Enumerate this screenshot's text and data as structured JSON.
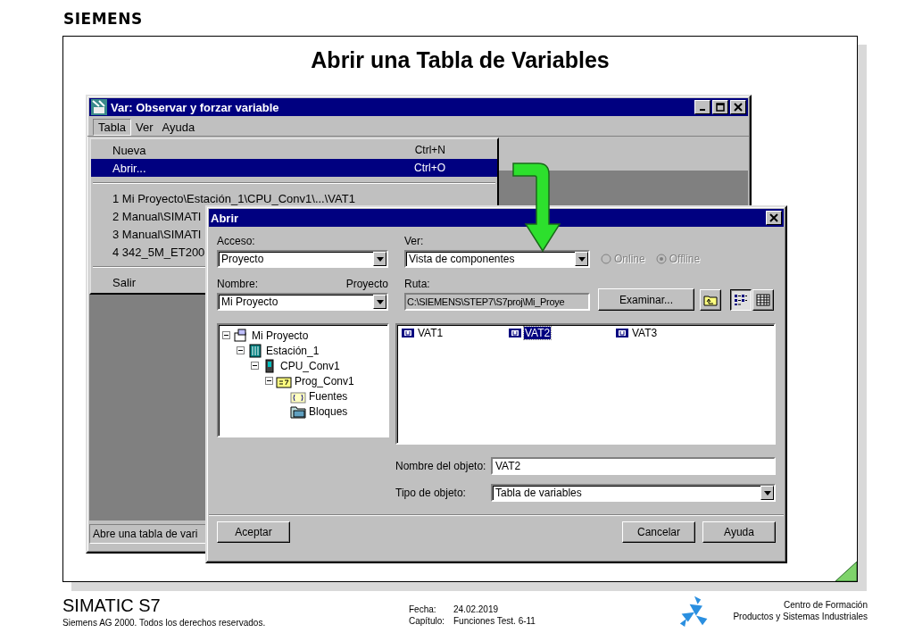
{
  "brand": "SIEMENS",
  "slide_title": "Abrir una Tabla de Variables",
  "main_window": {
    "title": "Var: Observar y forzar variable",
    "menu": [
      {
        "label": "Tabla",
        "selected": true
      },
      {
        "label": "Ver",
        "selected": false
      },
      {
        "label": "Ayuda",
        "selected": false
      }
    ],
    "dropdown": [
      {
        "kind": "item",
        "label": "Nueva",
        "shortcut": "Ctrl+N",
        "selected": false
      },
      {
        "kind": "item",
        "label": "Abrir...",
        "shortcut": "Ctrl+O",
        "selected": true
      },
      {
        "kind": "separator"
      },
      {
        "kind": "item",
        "label": "1 Mi Proyecto\\Estación_1\\CPU_Conv1\\...\\VAT1",
        "selected": false
      },
      {
        "kind": "item",
        "label": "2 Manual\\SIMATI",
        "selected": false
      },
      {
        "kind": "item",
        "label": "3 Manual\\SIMATI",
        "selected": false
      },
      {
        "kind": "item",
        "label": "4 342_5M_ET200",
        "selected": false
      },
      {
        "kind": "separator"
      },
      {
        "kind": "item",
        "label": "Salir",
        "selected": false
      }
    ],
    "status": "Abre una tabla de vari"
  },
  "dialog": {
    "title": "Abrir",
    "acceso": {
      "label": "Acceso:",
      "value": "Proyecto"
    },
    "ver": {
      "label": "Ver:",
      "value": "Vista de componentes"
    },
    "radios": [
      {
        "label": "Online",
        "selected": false,
        "disabled": true
      },
      {
        "label": "Offline",
        "selected": true,
        "disabled": true
      }
    ],
    "nombre": {
      "label": "Nombre:",
      "caption": "Proyecto",
      "value": "Mi Proyecto"
    },
    "ruta": {
      "label": "Ruta:",
      "value": "C:\\SIEMENS\\STEP7\\S7proj\\Mi_Proye"
    },
    "browse_button": "Examinar...",
    "views": [
      {
        "kind": "details",
        "selected": true
      },
      {
        "kind": "grid",
        "selected": false
      }
    ],
    "tree": [
      {
        "kind": "project",
        "label": "Mi Proyecto",
        "expanded": true,
        "children": [
          {
            "kind": "station",
            "label": "Estación_1",
            "expanded": true,
            "children": [
              {
                "kind": "cpu",
                "label": "CPU_Conv1",
                "expanded": true,
                "children": [
                  {
                    "kind": "program",
                    "label": "Prog_Conv1",
                    "expanded": true,
                    "children": [
                      {
                        "kind": "sources",
                        "label": "Fuentes"
                      },
                      {
                        "kind": "blocks",
                        "label": "Bloques"
                      }
                    ]
                  }
                ]
              }
            ]
          }
        ]
      }
    ],
    "files": [
      {
        "label": "VAT1",
        "selected": false
      },
      {
        "label": "VAT2",
        "selected": true
      },
      {
        "label": "VAT3",
        "selected": false
      }
    ],
    "object_name": {
      "label": "Nombre del objeto:",
      "value": "VAT2"
    },
    "object_type": {
      "label": "Tipo de objeto:",
      "value": "Tabla de variables"
    },
    "buttons": [
      {
        "kind": "left",
        "label": "Aceptar"
      },
      {
        "kind": "right",
        "label": "Cancelar"
      },
      {
        "kind": "right",
        "label": "Ayuda"
      }
    ]
  },
  "footer": {
    "product": "SIMATIC S7",
    "copyright": "Siemens AG 2000. Todos los derechos reservados.",
    "date_label": "Fecha:",
    "date": "24.02.2019",
    "chapter_label": "Capítulo:",
    "chapter": "Funciones Test. 6-11",
    "org_line1": "Centro de Formación",
    "org_line2": "Productos y Sistemas Industriales"
  }
}
